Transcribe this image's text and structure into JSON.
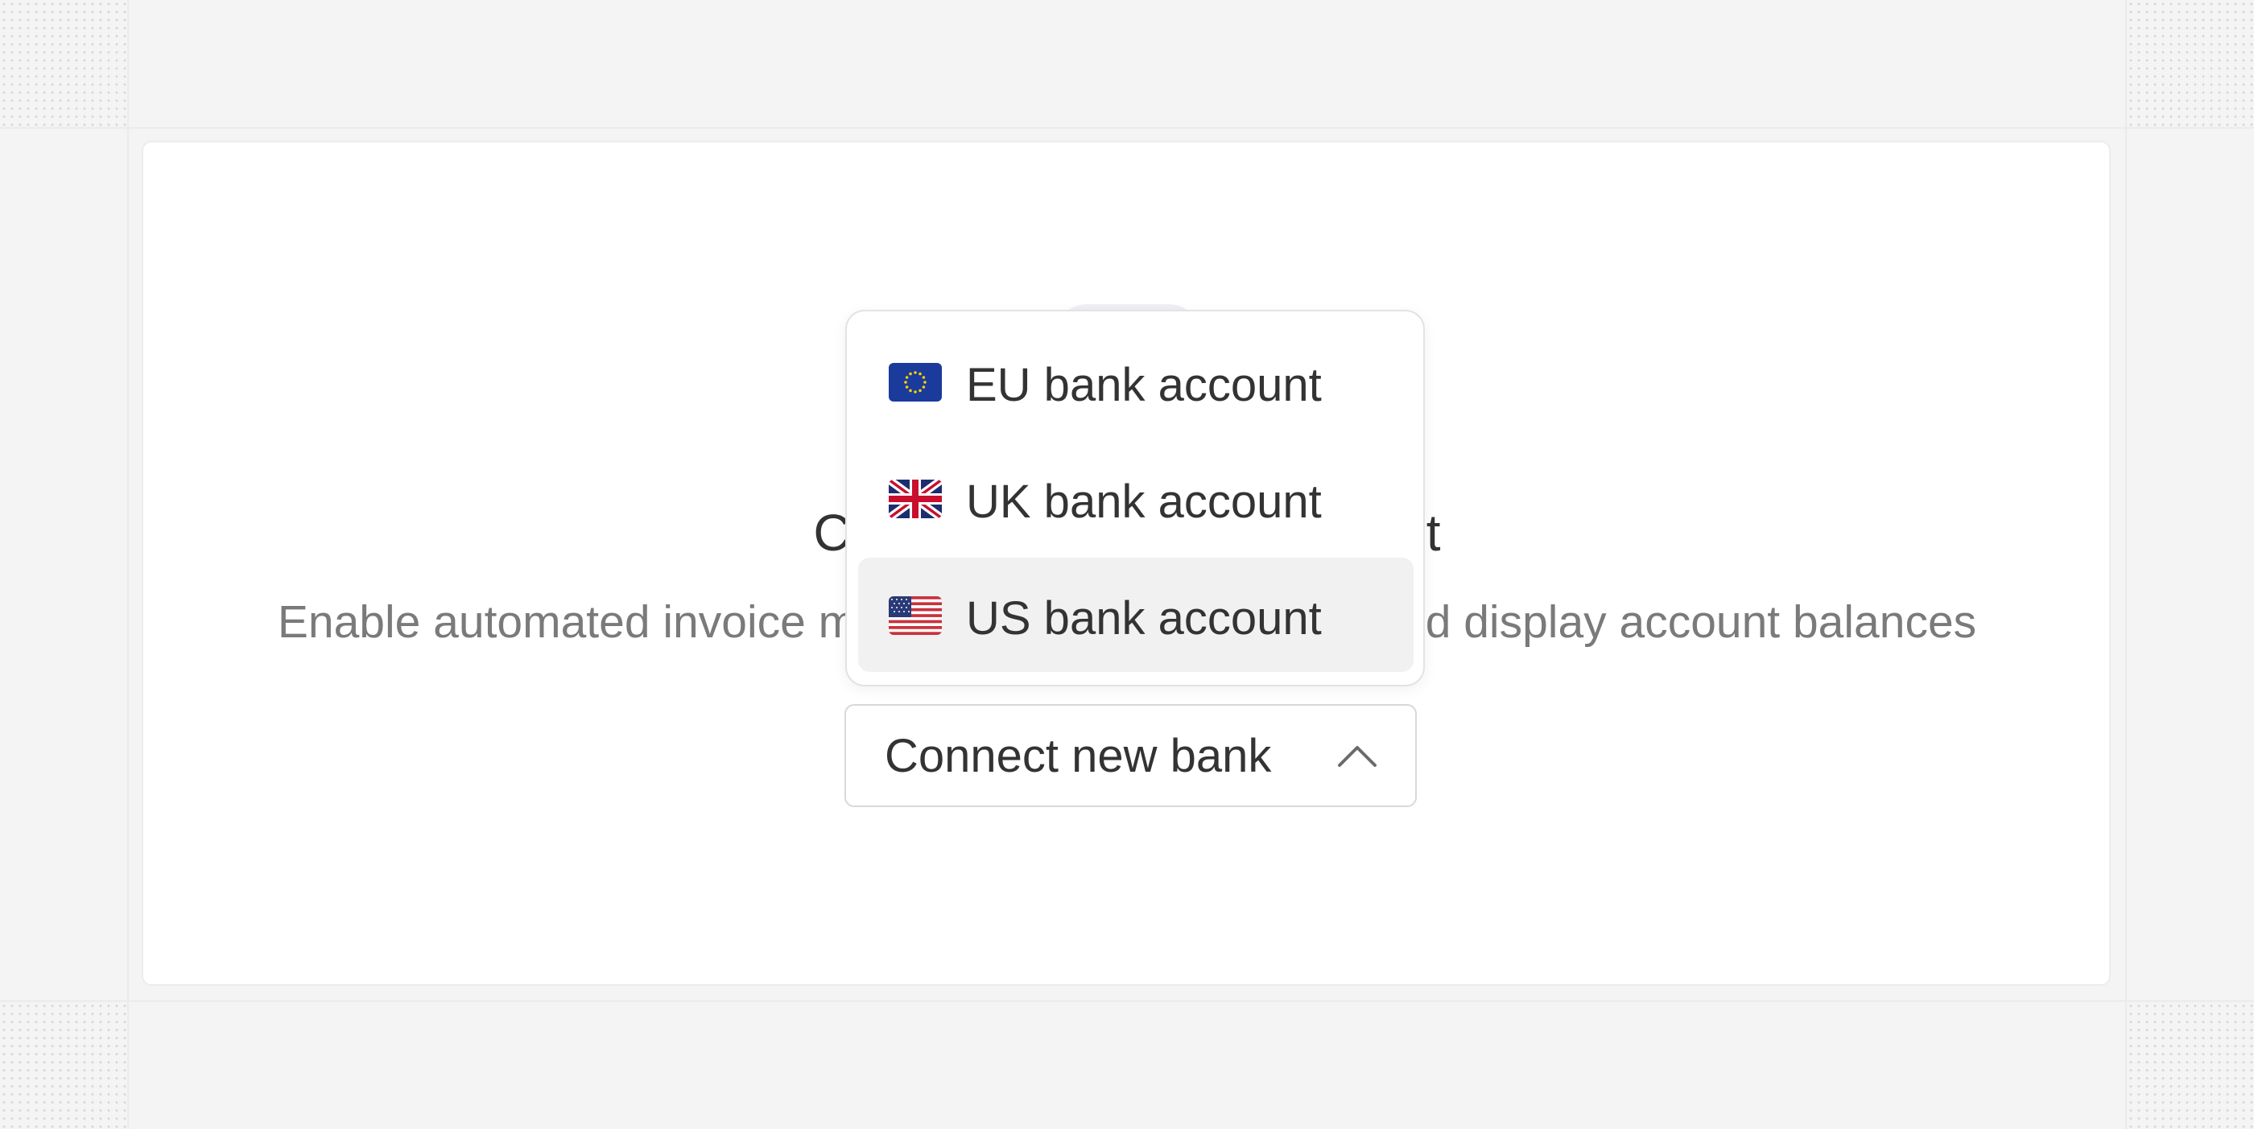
{
  "empty_state": {
    "title": "Connect your bank account",
    "subtitle": "Enable automated invoice matching, transaction sync and display account balances",
    "icon": "bank-icon"
  },
  "connect_button": {
    "label": "Connect new bank",
    "icon": "chevron-up-icon",
    "expanded": true
  },
  "dropdown": {
    "items": [
      {
        "label": "EU bank account",
        "icon": "eu-flag-icon",
        "active": false
      },
      {
        "label": "UK bank account",
        "icon": "uk-flag-icon",
        "active": false
      },
      {
        "label": "US bank account",
        "icon": "us-flag-icon",
        "active": true
      }
    ]
  },
  "colors": {
    "background": "#f4f4f4",
    "card": "#ffffff",
    "text": "#333333",
    "muted_text": "#7a7a7a",
    "active_item": "#f1f1f1"
  }
}
